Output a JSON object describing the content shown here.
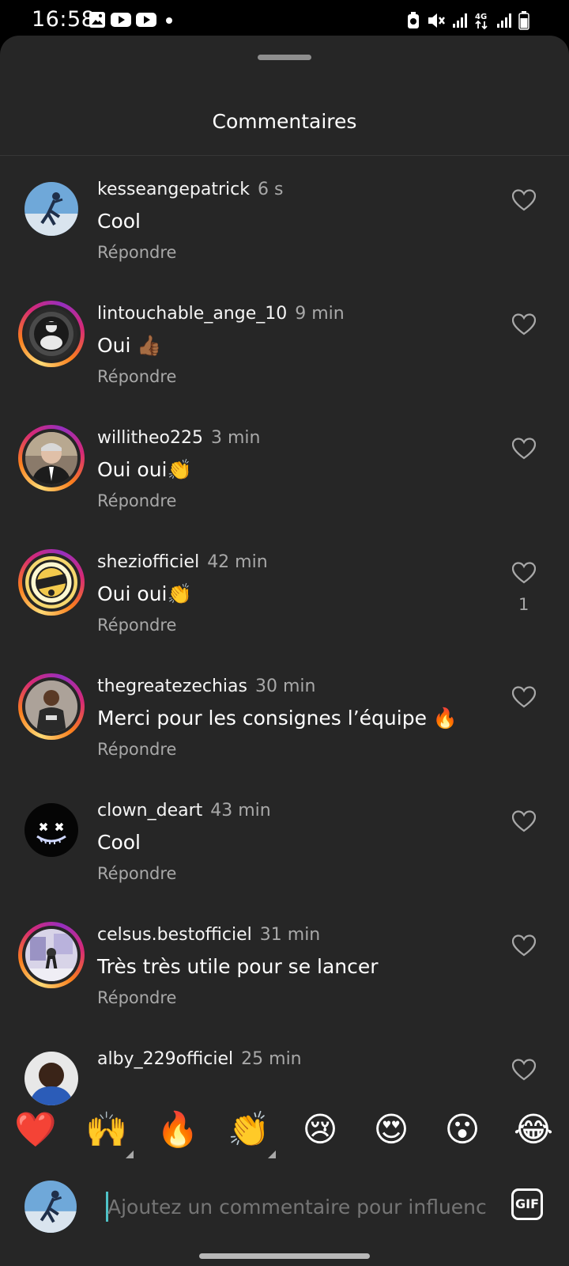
{
  "status_bar": {
    "time": "16:58",
    "left_icons": [
      "gallery-icon",
      "youtube-icon",
      "youtube-icon",
      "dot-icon"
    ],
    "right_icons": [
      "battery-saver-icon",
      "mute-icon",
      "signal-icon",
      "4g-icon",
      "signal-icon",
      "battery-icon"
    ],
    "network_label": "4G"
  },
  "sheet": {
    "title": "Commentaires"
  },
  "comments": [
    {
      "username": "kesseangepatrick",
      "time": "6 s",
      "text": "Cool",
      "reply": "Répondre",
      "likes": "",
      "story_ring": false
    },
    {
      "username": "lintouchable_ange_10",
      "time": "9 min",
      "text": "Oui 👍🏾",
      "reply": "Répondre",
      "likes": "",
      "story_ring": true
    },
    {
      "username": "willitheo225",
      "time": "3 min",
      "text": "Oui oui👏",
      "reply": "Répondre",
      "likes": "",
      "story_ring": true
    },
    {
      "username": "sheziofficiel",
      "time": "42 min",
      "text": "Oui oui👏",
      "reply": "Répondre",
      "likes": "1",
      "story_ring": true
    },
    {
      "username": "thegreatezechias",
      "time": "30 min",
      "text": "Merci pour les consignes l’équipe 🔥",
      "reply": "Répondre",
      "likes": "",
      "story_ring": true
    },
    {
      "username": "clown_deart",
      "time": "43 min",
      "text": "Cool",
      "reply": "Répondre",
      "likes": "",
      "story_ring": false
    },
    {
      "username": "celsus.bestofficiel",
      "time": "31 min",
      "text": "Très très utile pour se lancer",
      "reply": "Répondre",
      "likes": "",
      "story_ring": true
    },
    {
      "username": "alby_229officiel",
      "time": "25 min",
      "text": "",
      "reply": "",
      "likes": "",
      "story_ring": false
    }
  ],
  "emoji_bar": [
    "❤️",
    "🙌",
    "🔥",
    "👏",
    "😢",
    "😍",
    "😮",
    "😂"
  ],
  "composer": {
    "placeholder": "Ajoutez un commentaire pour influenceur",
    "gif_label": "GIF"
  },
  "colors": {
    "sheet_bg": "#262626",
    "secondary_text": "#a8a8a8",
    "story_ring": "#d62976"
  }
}
